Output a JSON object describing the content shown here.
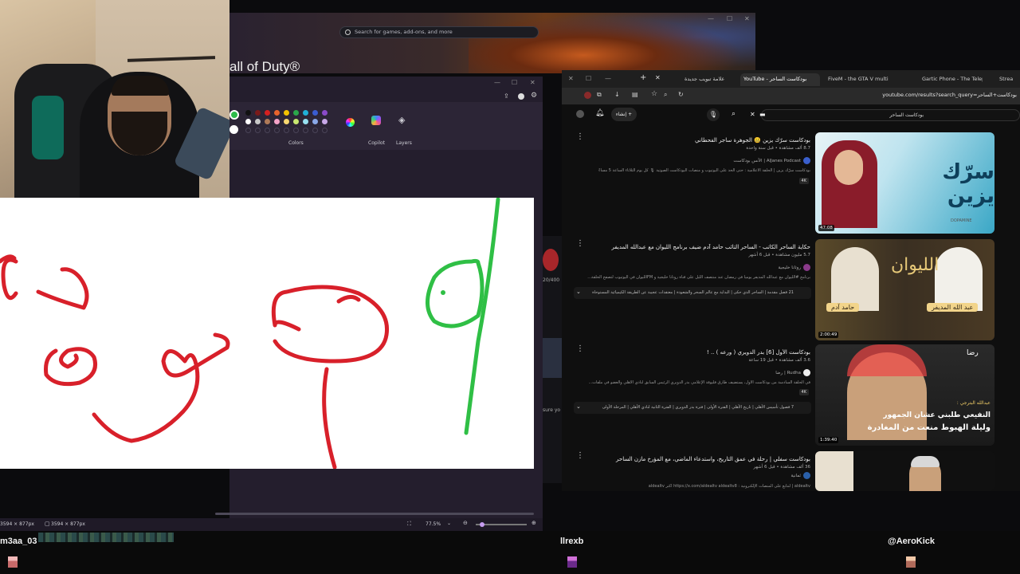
{
  "launcher": {
    "search_placeholder": "Search for games, add-ons, and more",
    "game_title": "all of Duty®"
  },
  "paint": {
    "colors_label": "Colors",
    "copilot_label": "Copilot",
    "layers_label": "Layers",
    "status_canvas_size_1": "3594 × 877px",
    "status_canvas_size_2": "3594 × 877px",
    "zoom": "77.5%",
    "palette": [
      "#111111",
      "#7a1a1a",
      "#d42020",
      "#e8642c",
      "#f2c200",
      "#2aa84a",
      "#20b0d8",
      "#3a5cd0",
      "#8a4ac8",
      "#ffffff",
      "#c8c8c8",
      "#b07a58",
      "#f5a3c8",
      "#f8d870",
      "#c8e870",
      "#98e0f0",
      "#8aa8e8",
      "#c8a8e8"
    ],
    "primary_color": "#2dbb4a",
    "secondary_color": "#ffffff"
  },
  "browser": {
    "tabs": [
      {
        "label": "علامة تبويب جديدة"
      },
      {
        "label": "YouTube - بودكاست الساحر"
      },
      {
        "label": "FiveM - the GTA V multiplay"
      },
      {
        "label": "Gartic Phone - The Telephone"
      },
      {
        "label": "Strea"
      }
    ],
    "url": "youtube.com/results?search_query=بودكاست+الساحر",
    "search_query": "بودكاست الساحر",
    "create_label": "إنشاء"
  },
  "videos": [
    {
      "title": "بودكاست سرّك يزين 🤐 الجوهرة ساجر الفحطاني",
      "meta": "8.7 ألف مشاهدة • قبل سنة واحدة",
      "channel": "AlJanes Podcast | الآنس بودكاست",
      "desc": "بودكاست سرّك يزين | الحلقة الاعلامية : حتى ألحد على اليوتيوب و منصات البودكاست الصوتية 🎙 كل يوم الثلاثاء الساعة 5 مساءً",
      "badge": "4K",
      "duration": "47:08",
      "thumb_text": "سرّك يزين"
    },
    {
      "title": "حكاية الساحر الكاتب - الساحر التائب حامد آدم ضيف برنامج الليوان مع عبدالله المديفر",
      "meta": "5.7 مليون مشاهدة • قبل 6 أشهر",
      "channel": "روتانا خليجية",
      "desc": "برنامج #الليوان مع عبدالله المديفر يوميا في رمضان عند منتصف الليل على قناة روتانا خليجية و FMالليوان في اليوتيوب لتصفح الحلقة...",
      "chapters": "21 فصل  مقدمة | الساحر الذي حكى | البداية مع عالم السحر والشعوذة | معتقدات عجيبة عن الطريقة الكيميائية المستوحاة",
      "duration": "2:00:49",
      "thumb_names": [
        "حامد آدم",
        "عبد الله المديفر"
      ],
      "thumb_logo": "الليوان"
    },
    {
      "title": "بودكاست الأول [6] بدر الدويري ( ورعه ) .. !",
      "meta": "3.6 ألف مشاهدة • قبل 19 ساعة",
      "channel": "Rudha | رضا",
      "desc": "في الحلقة السادسة من بودكاست الأول، يستضيف طارق فليوفة الإعلامي بدر الدويري الرئيس السابق لنادي الأهلي والعضو في ملفات...",
      "badge": "4K",
      "chapters": "7 فصول  تأسيس الأهلي | تاريخ الأهلي | الفترة الأولى | فترة بدر الدويري | الفترة الثانية لنادي الأهلي | المرحلة الأولى",
      "duration": "1:39:40",
      "thumb_line1": "عبدالله البترجي :",
      "thumb_line2": "النفيعي طلبني عشان الجمهور",
      "thumb_line3": "وليلة الهبوط منعت من المغادرة",
      "thumb_brand": "رضا"
    },
    {
      "title": "بودكاست سفلي | رحلة في عمق التاريخ، واستدعاء الماضي، مع المؤرخ مازن الساحر",
      "meta": "36 ألف مشاهدة • قبل 6 أشهر",
      "channel": "ثمانية",
      "desc": "aldealtv | لنتابع على المنصات الإلكترونية : https://x.com/aldealtv  aldealtv8 أكثر aldealtv",
      "duration": ""
    }
  ],
  "stream": {
    "user_left": "m3aa_03",
    "user_mid": "llrexb",
    "user_right": "@AeroKick"
  },
  "partial_texts": {
    "side_counter": "20/400",
    "side_text": "sure yo"
  }
}
